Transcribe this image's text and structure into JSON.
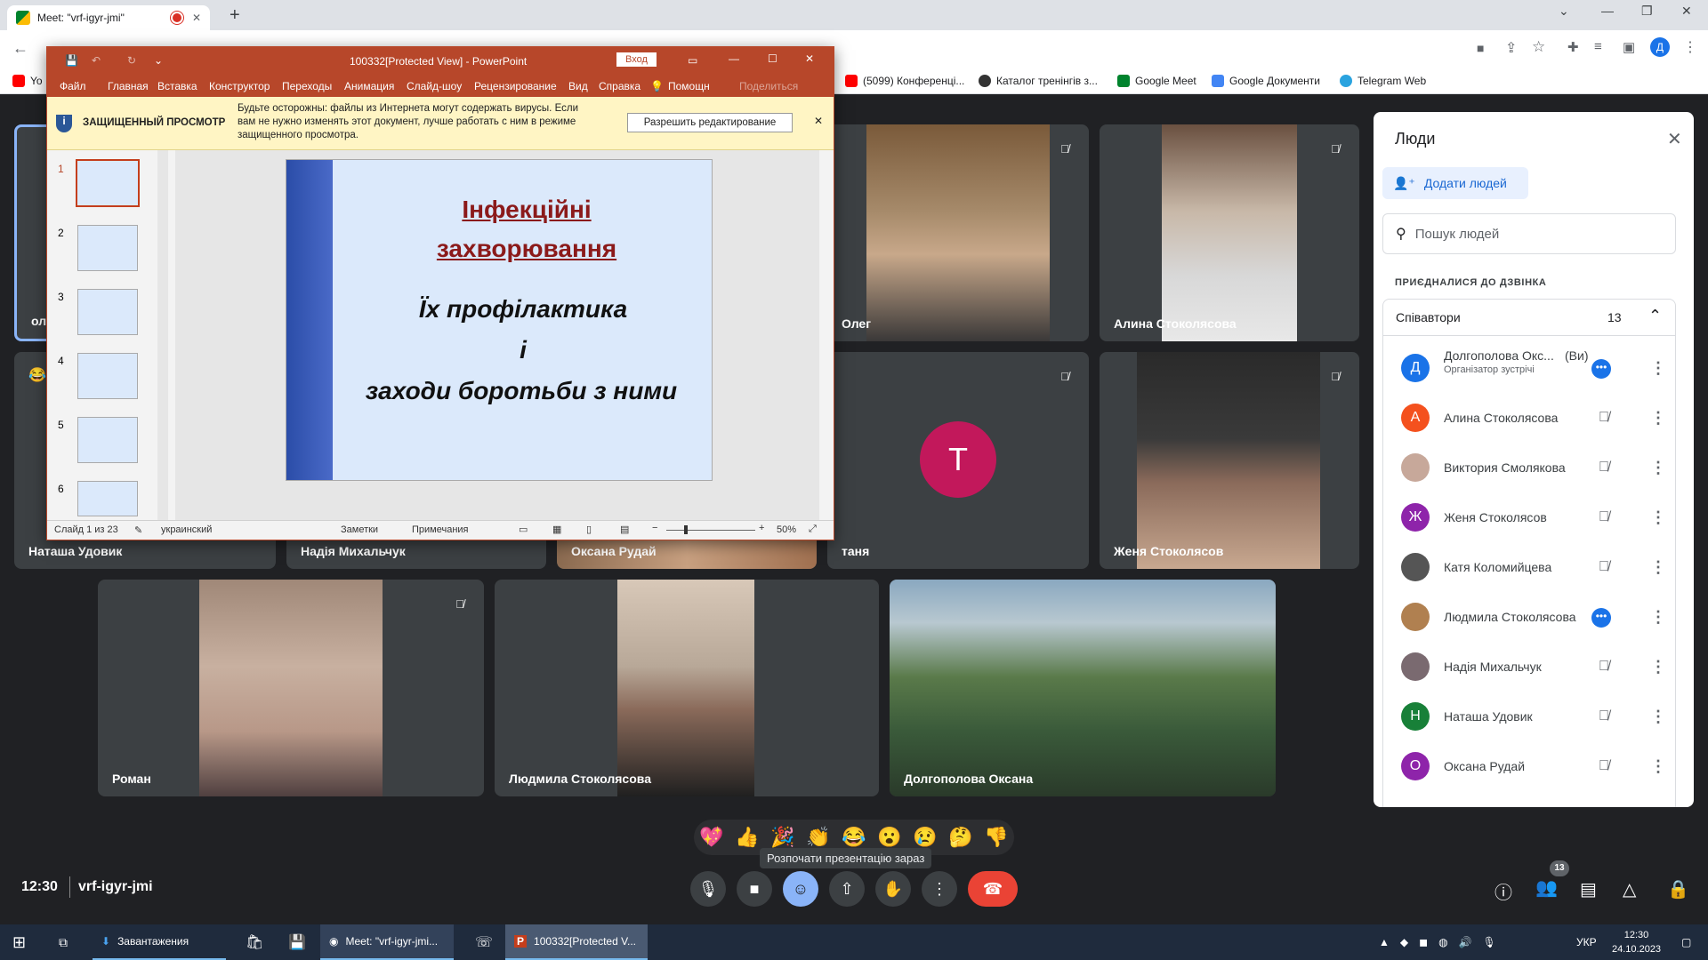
{
  "browser": {
    "tab_title": "Meet: \"vrf-igyr-jmi\"",
    "bookmarks": [
      "Yo",
      "(5099) Конференці...",
      "Каталог тренінгів з...",
      "Google Meet",
      "Google Документи",
      "Telegram Web"
    ],
    "profile_initial": "Д"
  },
  "powerpoint": {
    "title": "100332[Protected View] - PowerPoint",
    "login": "Вход",
    "ribbon": [
      "Файл",
      "Главная",
      "Вставка",
      "Конструктор",
      "Переходы",
      "Анимация",
      "Слайд-шоу",
      "Рецензирование",
      "Вид",
      "Справка",
      "Помощн",
      "Поделиться"
    ],
    "protected_label": "ЗАЩИЩЕННЫЙ ПРОСМОТР",
    "protected_msg": "Будьте осторожны: файлы из Интернета могут содержать вирусы. Если вам не нужно изменять этот документ, лучше работать с ним в режиме защищенного просмотра.",
    "enable_edit": "Разрешить редактирование",
    "thumb_numbers": [
      "1",
      "2",
      "3",
      "4",
      "5",
      "6"
    ],
    "slide_title": "Інфекційні захворювання",
    "slide_body_1": "Їх профілактика",
    "slide_body_2": "і",
    "slide_body_3": "заходи боротьби з ними",
    "status_slide": "Слайд 1 из 23",
    "status_lang": "украинский",
    "status_notes": "Заметки",
    "status_comments": "Примечания",
    "zoom": "50%"
  },
  "meet": {
    "tiles": [
      {
        "name": "ол"
      },
      {
        "name": "Олег"
      },
      {
        "name": "Алина Стоколясова"
      },
      {
        "name": "Наташа Удовик"
      },
      {
        "name": "Надія Михальчук"
      },
      {
        "name": "Оксана Рудай"
      },
      {
        "name": "таня",
        "initial": "Т"
      },
      {
        "name": "Женя Стоколясов"
      },
      {
        "name": "Роман"
      },
      {
        "name": "Людмила Стоколясова"
      },
      {
        "name": "Долгополова Оксана"
      }
    ],
    "reactions": [
      "💖",
      "👍",
      "🎉",
      "👏",
      "😂",
      "😮",
      "😢",
      "🤔",
      "👎"
    ],
    "tooltip": "Розпочати презентацію зараз",
    "time": "12:30",
    "meeting_code": "vrf-igyr-jmi",
    "participants_badge": "13"
  },
  "people_panel": {
    "title": "Люди",
    "add_people": "Додати людей",
    "search_placeholder": "Пошук людей",
    "joined_label": "ПРИЄДНАЛИСЯ ДО ДЗВІНКА",
    "section": "Співавтори",
    "count": "13",
    "people": [
      {
        "name": "Долгополова Окс...",
        "suffix": "(Ви)",
        "sub": "Організатор зустрічі",
        "initial": "Д",
        "color": "#1a73e8"
      },
      {
        "name": "Алина Стоколясова",
        "initial": "А",
        "color": "#f4511e"
      },
      {
        "name": "Виктория Смолякова",
        "initial": "",
        "color": "#c7a89a"
      },
      {
        "name": "Женя Стоколясов",
        "initial": "Ж",
        "color": "#8e24aa"
      },
      {
        "name": "Катя Коломийцева",
        "initial": "",
        "color": "#555"
      },
      {
        "name": "Людмила Стоколясова",
        "initial": "",
        "color": "#b08050"
      },
      {
        "name": "Надія Михальчук",
        "initial": "",
        "color": "#7a6a70"
      },
      {
        "name": "Наташа Удовик",
        "initial": "Н",
        "color": "#188038"
      },
      {
        "name": "Оксана Рудай",
        "initial": "О",
        "color": "#8e24aa"
      }
    ]
  },
  "taskbar": {
    "items": [
      "Завантажения",
      "Meet: \"vrf-igyr-jmi...",
      "100332[Protected V..."
    ],
    "lang": "УКР",
    "time": "12:30",
    "date": "24.10.2023"
  }
}
